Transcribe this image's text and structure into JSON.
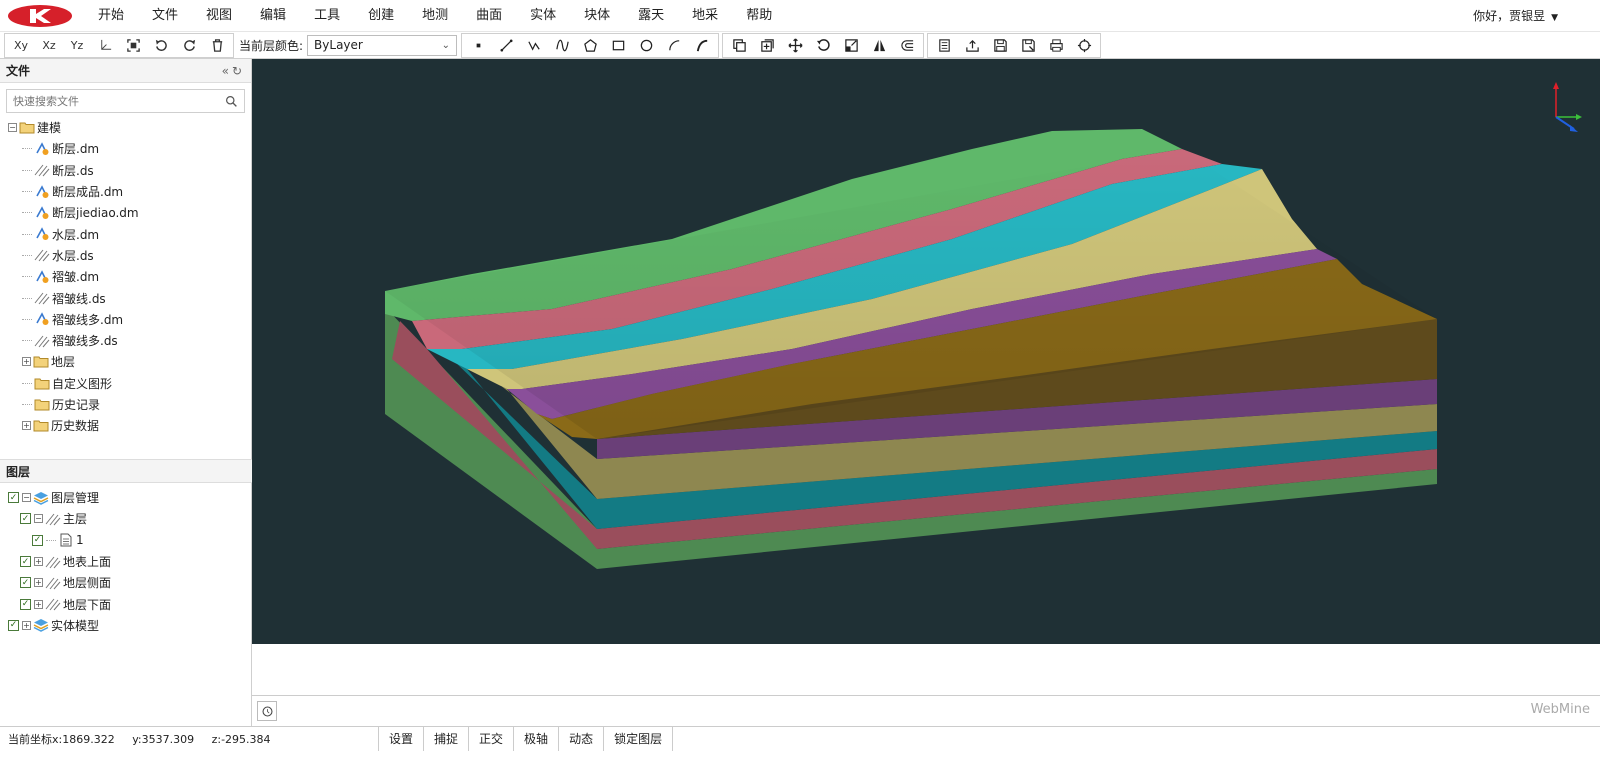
{
  "menu": [
    "开始",
    "文件",
    "视图",
    "编辑",
    "工具",
    "创建",
    "地测",
    "曲面",
    "实体",
    "块体",
    "露天",
    "地采",
    "帮助"
  ],
  "user": {
    "greeting": "你好，贾银昱"
  },
  "toolbar": {
    "layer_color_label": "当前层颜色:",
    "layer_color_value": "ByLayer",
    "view_buttons": [
      "Xy",
      "Xz",
      "Yz"
    ]
  },
  "file_panel": {
    "title": "文件",
    "search_placeholder": "快速搜索文件",
    "tree": [
      {
        "label": "建模",
        "type": "folder",
        "expanded": true,
        "level": 0
      },
      {
        "label": "断层.dm",
        "type": "dm",
        "level": 1
      },
      {
        "label": "断层.ds",
        "type": "ds",
        "level": 1
      },
      {
        "label": "断层成品.dm",
        "type": "dm",
        "level": 1
      },
      {
        "label": "断层jiediao.dm",
        "type": "dm",
        "level": 1
      },
      {
        "label": "水层.dm",
        "type": "dm",
        "level": 1
      },
      {
        "label": "水层.ds",
        "type": "ds",
        "level": 1
      },
      {
        "label": "褶皱.dm",
        "type": "dm",
        "level": 1
      },
      {
        "label": "褶皱线.ds",
        "type": "ds",
        "level": 1
      },
      {
        "label": "褶皱线多.dm",
        "type": "dm",
        "level": 1
      },
      {
        "label": "褶皱线多.ds",
        "type": "ds",
        "level": 1
      },
      {
        "label": "地层",
        "type": "folder",
        "expanded": false,
        "level": 1
      },
      {
        "label": "自定义图形",
        "type": "folder",
        "level": 1
      },
      {
        "label": "历史记录",
        "type": "folder",
        "level": 1
      },
      {
        "label": "历史数据",
        "type": "folder",
        "expanded": false,
        "level": 1
      }
    ]
  },
  "layer_panel": {
    "title": "图层",
    "tree": [
      {
        "label": "图层管理",
        "icon": "layers",
        "level": 0
      },
      {
        "label": "主层",
        "icon": "line",
        "level": 1
      },
      {
        "label": "1",
        "icon": "doc",
        "level": 2
      },
      {
        "label": "地表上面",
        "icon": "line",
        "level": 1
      },
      {
        "label": "地层侧面",
        "icon": "line",
        "level": 1
      },
      {
        "label": "地层下面",
        "icon": "line",
        "level": 1
      },
      {
        "label": "实体模型",
        "icon": "layers",
        "level": 0
      }
    ]
  },
  "status": {
    "x": "当前坐标x:1869.322",
    "y": "y:3537.309",
    "z": "z:-295.384",
    "buttons": [
      "设置",
      "捕捉",
      "正交",
      "极轴",
      "动态",
      "锁定图层"
    ]
  },
  "brand": "WebMine",
  "colors": {
    "viewport_bg": "#1f3035",
    "green": "#5fb86a",
    "pink": "#c9697a",
    "cyan": "#27b7c2",
    "yellow": "#cfc57a",
    "purple": "#8a4f9a",
    "brown": "#8a6a18"
  }
}
